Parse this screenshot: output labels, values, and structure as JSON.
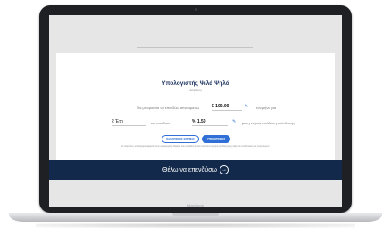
{
  "device": {
    "brand": "MacBook"
  },
  "calculator": {
    "title": "Υπολογιστής Ψιλά Ψηλά",
    "subtitle": "Ασφάλιση",
    "sentence_part1": "Θα μπορούσα να επενδύω αποταμιεύω",
    "amount": "€ 100.00",
    "sentence_part2": "τον μήνα για",
    "duration": "2 Έτη",
    "sentence_part3": "και απόδοση",
    "rate": "% 1.50",
    "sentence_part4": "μέση ετήσια απόδοση επένδυσης",
    "reset_button": "ΚΑΘΑΡΙΣΜΟΣ ΦΟΡΜΑΣ",
    "calculate_button": "ΥΠΟΛΟΓΙΣΜΟΣ",
    "disclaimer": "Οι παραπάνω υπολογισμοί αφορούν στην συγκεκριμένη διάρκεια που επιλέξατε και δεν συνιστούν εγγύηση απόδοσης της αξίας του επενδυτικού σας λογαριασμού."
  },
  "cta": {
    "label": "Θέλω να επενδύσω",
    "arrow": "arrow-right-icon"
  },
  "colors": {
    "navy": "#13294b",
    "accent": "#2f6fd6",
    "title": "#1f3460"
  }
}
